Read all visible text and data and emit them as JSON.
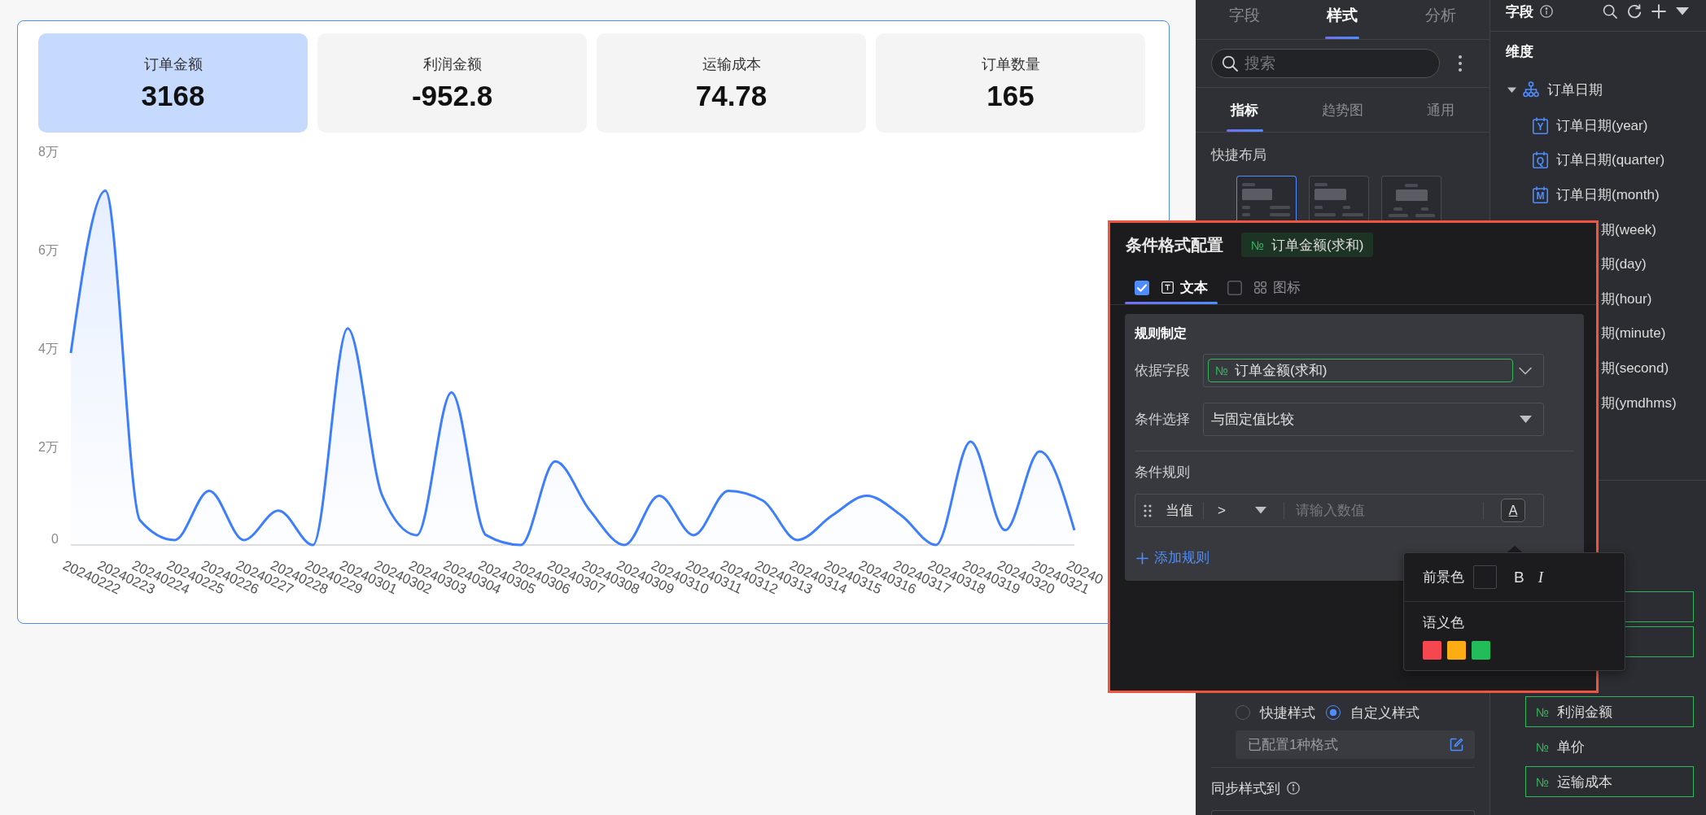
{
  "dashboard": {
    "kpi_cards": [
      {
        "label": "订单金额",
        "value": "3168",
        "selected": true
      },
      {
        "label": "利润金额",
        "value": "-952.8",
        "selected": false
      },
      {
        "label": "运输成本",
        "value": "74.78",
        "selected": false
      },
      {
        "label": "订单数量",
        "value": "165",
        "selected": false
      }
    ],
    "chart_data": {
      "type": "area",
      "categories": [
        "20240222",
        "20240223",
        "20240224",
        "20240225",
        "20240226",
        "20240227",
        "20240228",
        "20240229",
        "20240301",
        "20240302",
        "20240303",
        "20240304",
        "20240305",
        "20240306",
        "20240307",
        "20240308",
        "20240309",
        "20240310",
        "20240311",
        "20240312",
        "20240313",
        "20240314",
        "20240315",
        "20240316",
        "20240317",
        "20240318",
        "20240319",
        "20240320",
        "20240321",
        "20240"
      ],
      "values": [
        3.9,
        7.2,
        0.5,
        0.1,
        1.1,
        0.1,
        0.7,
        0,
        4.4,
        1.0,
        0.2,
        3.1,
        0.2,
        0,
        1.7,
        0.7,
        0,
        1.0,
        0.2,
        1.1,
        0.9,
        0.1,
        0.6,
        1.0,
        0.6,
        0,
        2.1,
        0.3,
        1.9,
        0.3
      ],
      "ylim": [
        0,
        8
      ],
      "yticks": [
        {
          "value": 0,
          "label": "0"
        },
        {
          "value": 2,
          "label": "2万"
        },
        {
          "value": 4,
          "label": "4万"
        },
        {
          "value": 6,
          "label": "6万"
        },
        {
          "value": 8,
          "label": "8万"
        }
      ]
    }
  },
  "style_panel": {
    "tabs": [
      {
        "label": "字段",
        "selected": false
      },
      {
        "label": "样式",
        "selected": true
      },
      {
        "label": "分析",
        "selected": false
      }
    ],
    "search": {
      "placeholder": "搜索"
    },
    "subtabs": [
      {
        "label": "指标",
        "selected": true
      },
      {
        "label": "趋势图",
        "selected": false
      },
      {
        "label": "通用",
        "selected": false
      }
    ],
    "quick_layout": {
      "title": "快捷布局",
      "options": [
        {
          "kind": "value-right",
          "selected": true
        },
        {
          "kind": "value-below",
          "selected": false
        },
        {
          "kind": "centered",
          "selected": false
        }
      ]
    },
    "format_mode": [
      {
        "label": "快捷样式",
        "selected": false
      },
      {
        "label": "自定义样式",
        "selected": true
      }
    ],
    "configured_formats": "已配置1种格式",
    "sync_label": "同步样式到"
  },
  "field_panel": {
    "title": "字段",
    "section": "维度",
    "tree": [
      {
        "label": "订单日期",
        "expanded": true,
        "children": [
          {
            "label": "订单日期(year)",
            "unit": "Y",
            "covered": false
          },
          {
            "label": "订单日期(quarter)",
            "unit": "Q",
            "covered": false
          },
          {
            "label": "订单日期(month)",
            "unit": "M",
            "covered": false
          },
          {
            "label": "期(week)",
            "covered": true
          },
          {
            "label": "期(day)",
            "covered": true
          },
          {
            "label": "期(hour)",
            "covered": true
          },
          {
            "label": "期(minute)",
            "covered": true
          },
          {
            "label": "期(second)",
            "covered": true
          },
          {
            "label": "期(ymdhms)",
            "covered": true
          }
        ]
      }
    ],
    "measures": [
      {
        "kind": "covered",
        "highlighted": true
      },
      {
        "kind": "covered",
        "highlighted": true
      },
      {
        "kind": "field",
        "type_icon": "№",
        "label": "利润金额",
        "highlighted": true
      },
      {
        "kind": "field",
        "type_icon": "№",
        "label": "单价",
        "highlighted": false
      },
      {
        "kind": "field",
        "type_icon": "№",
        "label": "运输成本",
        "highlighted": true
      }
    ]
  },
  "conditional_format": {
    "title": "条件格式配置",
    "field_tag": {
      "type_icon": "№",
      "label": "订单金额(求和)"
    },
    "format_tabs": [
      {
        "kind": "text",
        "label": "文本",
        "checked": true,
        "selected": true
      },
      {
        "kind": "icon",
        "label": "图标",
        "checked": false,
        "selected": false
      }
    ],
    "rule_settings": {
      "title": "规则制定",
      "basis_field": {
        "label": "依据字段",
        "type_icon": "№",
        "value": "订单金额(求和)"
      },
      "condition": {
        "label": "条件选择",
        "value": "与固定值比较"
      },
      "rules_title": "条件规则",
      "rules": [
        {
          "subject": "当值",
          "operator": ">",
          "placeholder": "请输入数值",
          "style_button": "A"
        }
      ],
      "add_rule": "添加规则"
    }
  },
  "text_style_popover": {
    "foreground_label": "前景色",
    "bold": "B",
    "italic": "I",
    "semantic_label": "语义色",
    "swatches": [
      {
        "color": "#f5474f"
      },
      {
        "color": "#fdad14"
      },
      {
        "color": "#22bc5b"
      }
    ]
  }
}
